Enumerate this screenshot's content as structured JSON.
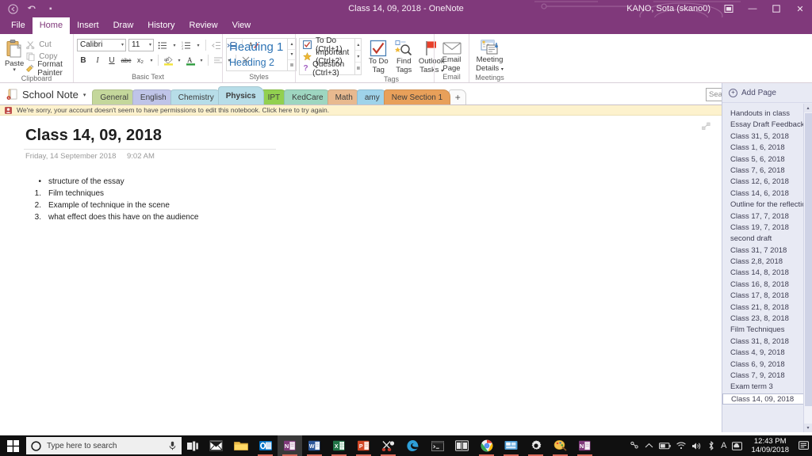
{
  "titlebar": {
    "qat": [
      {
        "name": "back-icon",
        "glyph": "←"
      },
      {
        "name": "undo-icon",
        "glyph": "↶"
      },
      {
        "name": "customize-qat-icon",
        "glyph": "▾"
      }
    ],
    "title": "Class 14, 09, 2018  -  OneNote",
    "account": "KANO, Sota (skano0)",
    "ribbon_display_options": "⬒",
    "minimize": "—",
    "restore": "❐",
    "close": "✕"
  },
  "menu": {
    "tabs": [
      {
        "label": "File",
        "active": false
      },
      {
        "label": "Home",
        "active": true
      },
      {
        "label": "Insert",
        "active": false
      },
      {
        "label": "Draw",
        "active": false
      },
      {
        "label": "History",
        "active": false
      },
      {
        "label": "Review",
        "active": false
      },
      {
        "label": "View",
        "active": false
      }
    ]
  },
  "ribbon": {
    "clipboard": {
      "group_label": "Clipboard",
      "paste_label": "Paste",
      "paste_caret": "▾",
      "items": [
        {
          "label": "Cut",
          "icon": "scissors-icon",
          "glyph": "✂",
          "enabled": false
        },
        {
          "label": "Copy",
          "icon": "copy-icon",
          "glyph": "❐",
          "enabled": false
        },
        {
          "label": "Format Painter",
          "icon": "format-painter-icon",
          "glyph": "✒",
          "enabled": true
        }
      ]
    },
    "basic_text": {
      "group_label": "Basic Text",
      "font_name": "Calibri",
      "font_size": "11",
      "row1": [
        {
          "name": "bullets-icon",
          "glyph": "☰"
        },
        {
          "name": "bullets-caret-icon",
          "glyph": "▾"
        },
        {
          "name": "numbering-icon",
          "glyph": "☰"
        },
        {
          "name": "numbering-caret-icon",
          "glyph": "▾"
        },
        {
          "name": "decrease-indent-icon",
          "glyph": "⇤"
        },
        {
          "name": "increase-indent-icon",
          "glyph": "⇥"
        },
        {
          "name": "styles-pane-icon",
          "glyph": "A"
        }
      ],
      "row2": [
        {
          "name": "bold-icon",
          "glyph": "B"
        },
        {
          "name": "italic-icon",
          "glyph": "I"
        },
        {
          "name": "underline-icon",
          "glyph": "U"
        },
        {
          "name": "strikethrough-icon",
          "glyph": "abc"
        },
        {
          "name": "subscript-icon",
          "glyph": "x₂"
        },
        {
          "name": "subscript-caret-icon",
          "glyph": "▾"
        },
        {
          "name": "text-highlight-icon",
          "glyph": "ab"
        },
        {
          "name": "highlight-caret-icon",
          "glyph": "▾"
        },
        {
          "name": "font-color-icon",
          "glyph": "A"
        },
        {
          "name": "font-color-caret-icon",
          "glyph": "▾"
        },
        {
          "name": "align-icon",
          "glyph": "≡"
        },
        {
          "name": "align-caret-icon",
          "glyph": "▾"
        },
        {
          "name": "clear-formatting-icon",
          "glyph": "✕"
        }
      ]
    },
    "styles": {
      "group_label": "Styles",
      "items": [
        "Heading 1",
        "Heading 2"
      ],
      "scroll": [
        "▴",
        "▾",
        "≣"
      ]
    },
    "tags": {
      "group_label": "Tags",
      "items": [
        {
          "label": "To Do (Ctrl+1)",
          "icon": "todo-checkbox-icon",
          "glyph": "✓"
        },
        {
          "label": "Important (Ctrl+2)",
          "icon": "star-icon",
          "glyph": "★"
        },
        {
          "label": "Question (Ctrl+3)",
          "icon": "question-mark-icon",
          "glyph": "?"
        }
      ],
      "scroll": [
        "▴",
        "▾",
        "≣"
      ],
      "todo_tag": "To Do\nTag",
      "todo_tag_l1": "To Do",
      "todo_tag_l2": "Tag",
      "find_tags_l1": "Find",
      "find_tags_l2": "Tags",
      "outlook_tasks_l1": "Outlook",
      "outlook_tasks_l2": "Tasks",
      "outlook_caret": "▾"
    },
    "email": {
      "group_label": "Email",
      "label_l1": "Email",
      "label_l2": "Page"
    },
    "meetings": {
      "group_label": "Meetings",
      "label_l1": "Meeting",
      "label_l2": "Details",
      "caret": "▾"
    }
  },
  "notebook": {
    "name": "School Note",
    "caret": "▾",
    "sections": [
      {
        "label": "General",
        "color": "#c4d79b",
        "active": false
      },
      {
        "label": "English",
        "color": "#bfc4e8",
        "active": false
      },
      {
        "label": "Chemistry",
        "color": "#b7dde8",
        "active": false
      },
      {
        "label": "Physics",
        "color": "#b7dde8",
        "active": true
      },
      {
        "label": "IPT",
        "color": "#92d050",
        "active": false
      },
      {
        "label": "KedCare",
        "color": "#9ed6c0",
        "active": false
      },
      {
        "label": "Math",
        "color": "#e8b98f",
        "active": false
      },
      {
        "label": "amy",
        "color": "#9fd3ea",
        "active": false
      },
      {
        "label": "New Section 1",
        "color": "#e8a05a",
        "active": false
      }
    ],
    "add_section": "+",
    "search": {
      "placeholder": "Search (Ctrl+E)",
      "icon": "search-icon",
      "caret": "▾"
    }
  },
  "warning": {
    "icon": "warning-account-icon",
    "text": "We're sorry, your account doesn't seem to have permissions to edit this notebook. Click here to try again."
  },
  "page": {
    "title": "Class 14, 09, 2018",
    "date": "Friday, 14 September 2018",
    "time": "9:02 AM",
    "expand_icon": "expand-arrows-icon",
    "body": [
      {
        "marker": "•",
        "text": "structure of the essay"
      },
      {
        "marker": "1.",
        "text": "Film techniques"
      },
      {
        "marker": "2.",
        "text": "Example of technique in the scene"
      },
      {
        "marker": "3.",
        "text": "what effect does this have on the audience"
      }
    ]
  },
  "page_pane": {
    "add_page_label": "Add Page",
    "add_page_icon": "plus-circle-icon",
    "scroll_up": "▴",
    "scroll_down": "▾",
    "pages": [
      {
        "label": "Handouts in class",
        "active": false
      },
      {
        "label": "Essay Draft Feedback",
        "active": false
      },
      {
        "label": "Class 31, 5, 2018",
        "active": false
      },
      {
        "label": "Class 1, 6, 2018",
        "active": false
      },
      {
        "label": "Class 5, 6, 2018",
        "active": false
      },
      {
        "label": "Class 7, 6, 2018",
        "active": false
      },
      {
        "label": "Class 12, 6, 2018",
        "active": false
      },
      {
        "label": "Class 14, 6, 2018",
        "active": false
      },
      {
        "label": "Outline for the reflectio",
        "active": false
      },
      {
        "label": "Class 17, 7, 2018",
        "active": false
      },
      {
        "label": "Class 19, 7, 2018",
        "active": false
      },
      {
        "label": "second draft",
        "active": false
      },
      {
        "label": "Class 31, 7 2018",
        "active": false
      },
      {
        "label": "Class 2,8, 2018",
        "active": false
      },
      {
        "label": "Class 14, 8, 2018",
        "active": false
      },
      {
        "label": "Class 16, 8, 2018",
        "active": false
      },
      {
        "label": "Class 17, 8, 2018",
        "active": false
      },
      {
        "label": "Class 21, 8, 2018",
        "active": false
      },
      {
        "label": "Class 23, 8, 2018",
        "active": false
      },
      {
        "label": "Film Techniques",
        "active": false
      },
      {
        "label": "Class 31, 8, 2018",
        "active": false
      },
      {
        "label": "Class 4, 9, 2018",
        "active": false
      },
      {
        "label": "Class 6, 9, 2018",
        "active": false
      },
      {
        "label": "Class 7, 9, 2018",
        "active": false
      },
      {
        "label": "Exam term 3",
        "active": false
      },
      {
        "label": "Class 14, 09, 2018",
        "active": true
      }
    ]
  },
  "taskbar": {
    "start_icon": "windows-start-icon",
    "search_placeholder": "Type here to search",
    "search_icon": "cortana-circle-icon",
    "mic_icon": "microphone-icon",
    "taskview_icon": "task-view-icon",
    "apps": [
      {
        "name": "mail-icon",
        "label": "Mail"
      },
      {
        "name": "file-explorer-icon",
        "label": "File Explorer"
      },
      {
        "name": "outlook-icon",
        "label": "Outlook"
      },
      {
        "name": "onenote-2016-icon",
        "label": "OneNote 2016"
      },
      {
        "name": "word-icon",
        "label": "Word"
      },
      {
        "name": "excel-icon",
        "label": "Excel"
      },
      {
        "name": "powerpoint-icon",
        "label": "PowerPoint"
      },
      {
        "name": "snipping-tool-icon",
        "label": "Snipping Tool"
      },
      {
        "name": "edge-icon",
        "label": "Microsoft Edge"
      },
      {
        "name": "command-prompt-icon",
        "label": "Command Prompt"
      },
      {
        "name": "reader-icon",
        "label": "Reader"
      },
      {
        "name": "chrome-icon",
        "label": "Google Chrome"
      },
      {
        "name": "remote-desktop-icon",
        "label": "Remote Desktop"
      },
      {
        "name": "settings-icon",
        "label": "Settings"
      },
      {
        "name": "paint-icon",
        "label": "Paint"
      },
      {
        "name": "onenote-icon",
        "label": "OneNote"
      }
    ],
    "tray": [
      {
        "name": "people-icon",
        "glyph": "⚘"
      },
      {
        "name": "show-hidden-icons-icon",
        "glyph": "∧"
      },
      {
        "name": "battery-icon",
        "glyph": "■"
      },
      {
        "name": "wifi-icon",
        "glyph": "◠"
      },
      {
        "name": "volume-icon",
        "glyph": "◂"
      },
      {
        "name": "bluetooth-icon",
        "glyph": "⎇"
      },
      {
        "name": "language-icon",
        "glyph": "A"
      },
      {
        "name": "onedrive-icon",
        "glyph": "☁"
      }
    ],
    "clock_time": "12:43 PM",
    "clock_date": "14/09/2018",
    "action_center_icon": "action-center-icon"
  }
}
